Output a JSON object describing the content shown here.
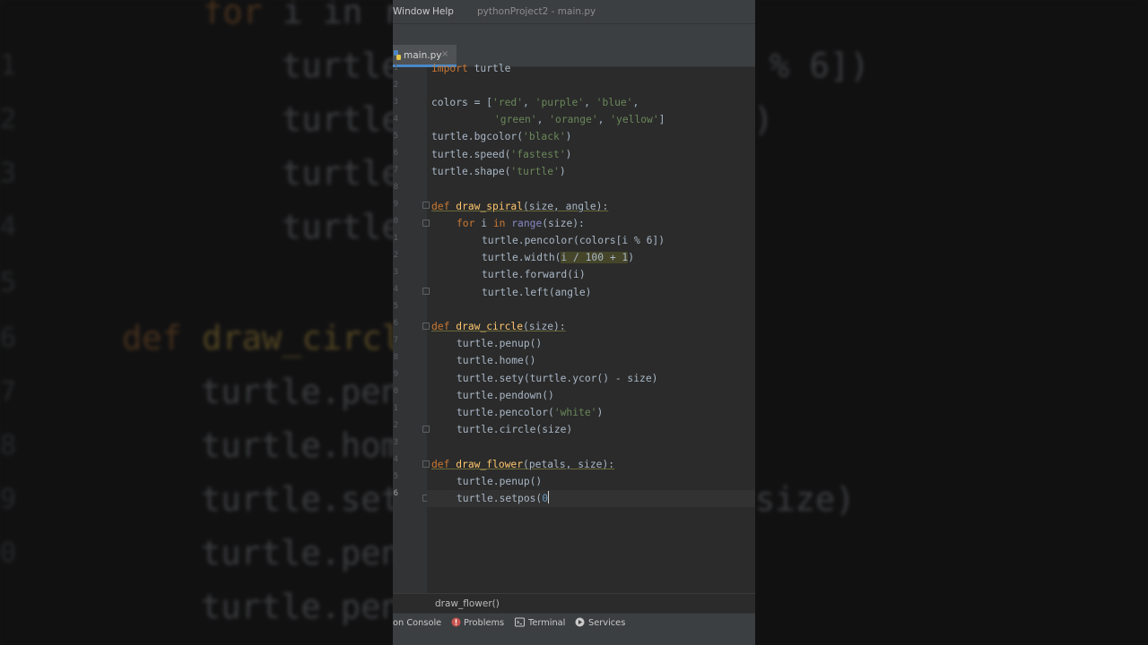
{
  "window": {
    "menu_window": "Window",
    "menu_help": "Help",
    "title": "pythonProject2 - main.py"
  },
  "tab": {
    "label": "main.py",
    "close": "×"
  },
  "gutter_numbers": [
    "1",
    "2",
    "3",
    "4",
    "5",
    "6",
    "7",
    "8",
    "9",
    "0",
    "1",
    "2",
    "3",
    "4",
    "5",
    "6",
    "7",
    "8",
    "9",
    "0",
    "1",
    "2",
    "3",
    "4",
    "5",
    "6"
  ],
  "code": {
    "l1_kw": "import",
    "l1_rest": " turtle",
    "l3_a": "colors = [",
    "l3_s1": "'red'",
    "l3_c1": ", ",
    "l3_s2": "'purple'",
    "l3_c2": ", ",
    "l3_s3": "'blue'",
    "l3_c3": ",",
    "l4_s1": "'green'",
    "l4_c1": ", ",
    "l4_s2": "'orange'",
    "l4_c2": ", ",
    "l4_s3": "'yellow'",
    "l4_end": "]",
    "l5_a": "turtle.bgcolor(",
    "l5_s": "'black'",
    "l5_end": ")",
    "l6_a": "turtle.speed(",
    "l6_s": "'fastest'",
    "l6_end": ")",
    "l7_a": "turtle.shape(",
    "l7_s": "'turtle'",
    "l7_end": ")",
    "l9_def": "def",
    "l9_fn": "draw_spiral",
    "l9_params": "(size, angle):",
    "l10_for": "for",
    "l10_i": " i ",
    "l10_in": "in",
    "l10_range": "range",
    "l10_rest": "(size):",
    "l11": "turtle.pencolor(colors[i % 6])",
    "l12_a": "turtle.width(",
    "l12_hl": "i / 100 + 1",
    "l12_end": ")",
    "l13": "turtle.forward(i)",
    "l14": "turtle.left(angle)",
    "l16_def": "def",
    "l16_fn": "draw_circle",
    "l16_params": "(size):",
    "l17": "turtle.penup()",
    "l18": "turtle.home()",
    "l19": "turtle.sety(turtle.ycor() - size)",
    "l20": "turtle.pendown()",
    "l21_a": "turtle.pencolor(",
    "l21_s": "'white'",
    "l21_end": ")",
    "l22": "turtle.circle(size)",
    "l24_def": "def",
    "l24_fn": "draw_flower",
    "l24_params": "(petals, size):",
    "l25": "turtle.penup()",
    "l26_a": "turtle.setpos(",
    "l26_n": "0"
  },
  "background": {
    "for_kw": "for",
    "for_rest": " i in r",
    "line_a": "turtle",
    "line_a_tail": "% 6])",
    "line_b": "turtle",
    "line_b_tail": ")",
    "line_c": "turtle",
    "line_d": "turtle",
    "def_kw": "def",
    "def_fn": "draw_circl",
    "b1": "turtle.pen",
    "b2": "turtle.hom",
    "b3": "turtle.set",
    "b3_tail": "size)",
    "b4": "turtle.pen",
    "b5": "turtle.pen",
    "nums": [
      "1",
      "2",
      "3",
      "4",
      "5",
      "6",
      "7",
      "8",
      "9",
      "0"
    ]
  },
  "breadcrumb": {
    "label": "draw_flower()"
  },
  "toolwindows": {
    "console": "on Console",
    "problems": "Problems",
    "terminal": "Terminal",
    "services": "Services"
  },
  "colors": {
    "editor_bg": "#2b2b2b",
    "keyword": "#cc7832",
    "function": "#ffc66d",
    "string": "#6a8759",
    "builtin": "#8888c6",
    "accent": "#4a88c7"
  }
}
